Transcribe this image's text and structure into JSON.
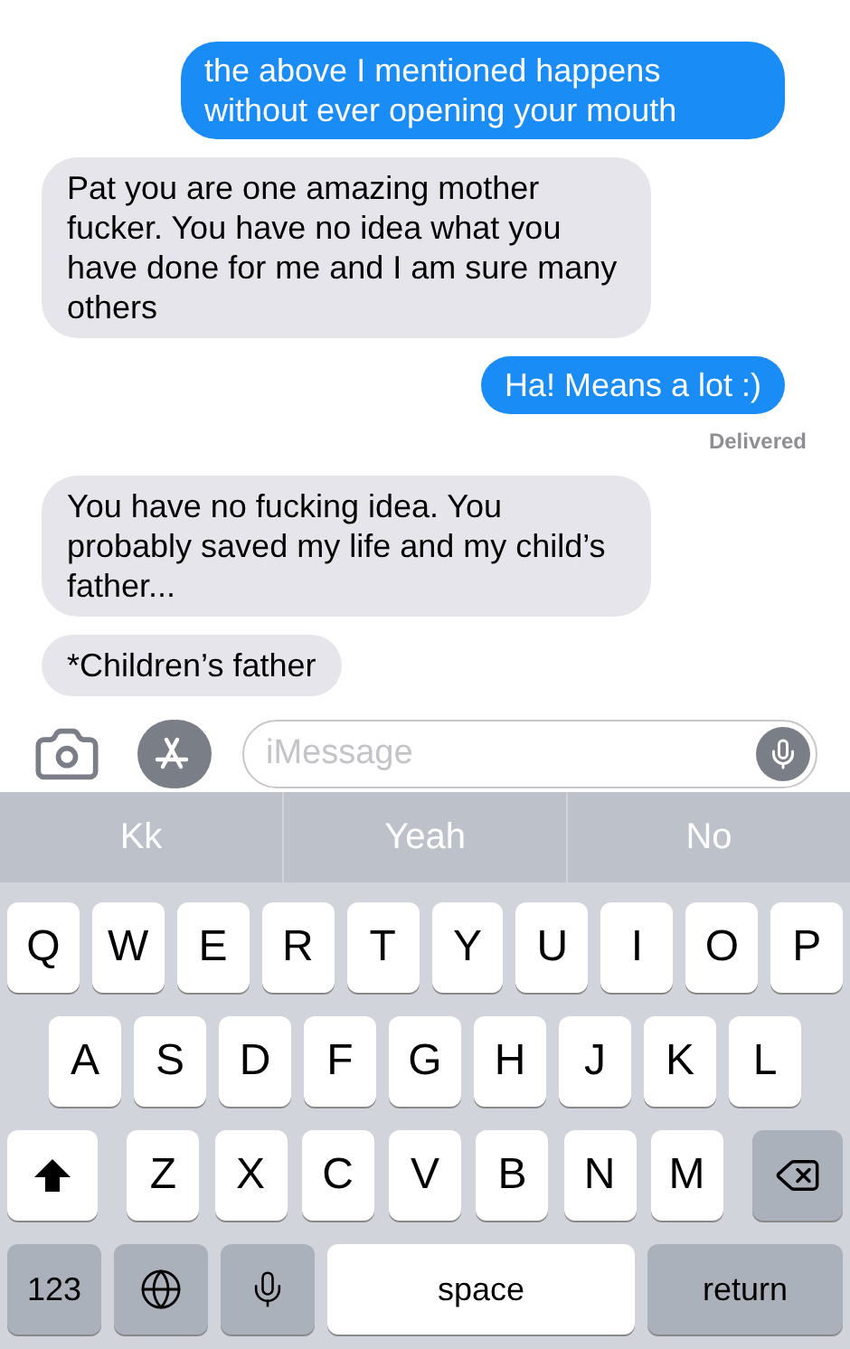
{
  "messages": [
    {
      "kind": "sent",
      "text": "the above I mentioned happens without ever opening your mouth"
    },
    {
      "kind": "received",
      "text": "Pat you are one amazing mother fucker. You have no idea what you have done for me and I am sure many others"
    },
    {
      "kind": "sent",
      "text": "Ha! Means a lot :)"
    },
    {
      "kind": "status",
      "text": "Delivered"
    },
    {
      "kind": "received",
      "text": "You have no fucking idea. You probably saved my life and my child’s father..."
    },
    {
      "kind": "received",
      "text": "*Children’s father"
    }
  ],
  "composer": {
    "placeholder": "iMessage"
  },
  "suggestions": [
    "Kk",
    "Yeah",
    "No"
  ],
  "keyboard": [
    [
      {
        "kind": "letter",
        "label": "Q"
      },
      {
        "kind": "letter",
        "label": "W"
      },
      {
        "kind": "letter",
        "label": "E"
      },
      {
        "kind": "letter",
        "label": "R"
      },
      {
        "kind": "letter",
        "label": "T"
      },
      {
        "kind": "letter",
        "label": "Y"
      },
      {
        "kind": "letter",
        "label": "U"
      },
      {
        "kind": "letter",
        "label": "I"
      },
      {
        "kind": "letter",
        "label": "O"
      },
      {
        "kind": "letter",
        "label": "P"
      }
    ],
    [
      {
        "kind": "letter",
        "label": "A"
      },
      {
        "kind": "letter",
        "label": "S"
      },
      {
        "kind": "letter",
        "label": "D"
      },
      {
        "kind": "letter",
        "label": "F"
      },
      {
        "kind": "letter",
        "label": "G"
      },
      {
        "kind": "letter",
        "label": "H"
      },
      {
        "kind": "letter",
        "label": "J"
      },
      {
        "kind": "letter",
        "label": "K"
      },
      {
        "kind": "letter",
        "label": "L"
      }
    ],
    [
      {
        "kind": "shift"
      },
      {
        "kind": "letter",
        "label": "Z"
      },
      {
        "kind": "letter",
        "label": "X"
      },
      {
        "kind": "letter",
        "label": "C"
      },
      {
        "kind": "letter",
        "label": "V"
      },
      {
        "kind": "letter",
        "label": "B"
      },
      {
        "kind": "letter",
        "label": "N"
      },
      {
        "kind": "letter",
        "label": "M"
      },
      {
        "kind": "backspace"
      }
    ],
    [
      {
        "kind": "mode",
        "label": "123"
      },
      {
        "kind": "globe"
      },
      {
        "kind": "mic"
      },
      {
        "kind": "space",
        "label": "space"
      },
      {
        "kind": "return",
        "label": "return"
      }
    ]
  ]
}
